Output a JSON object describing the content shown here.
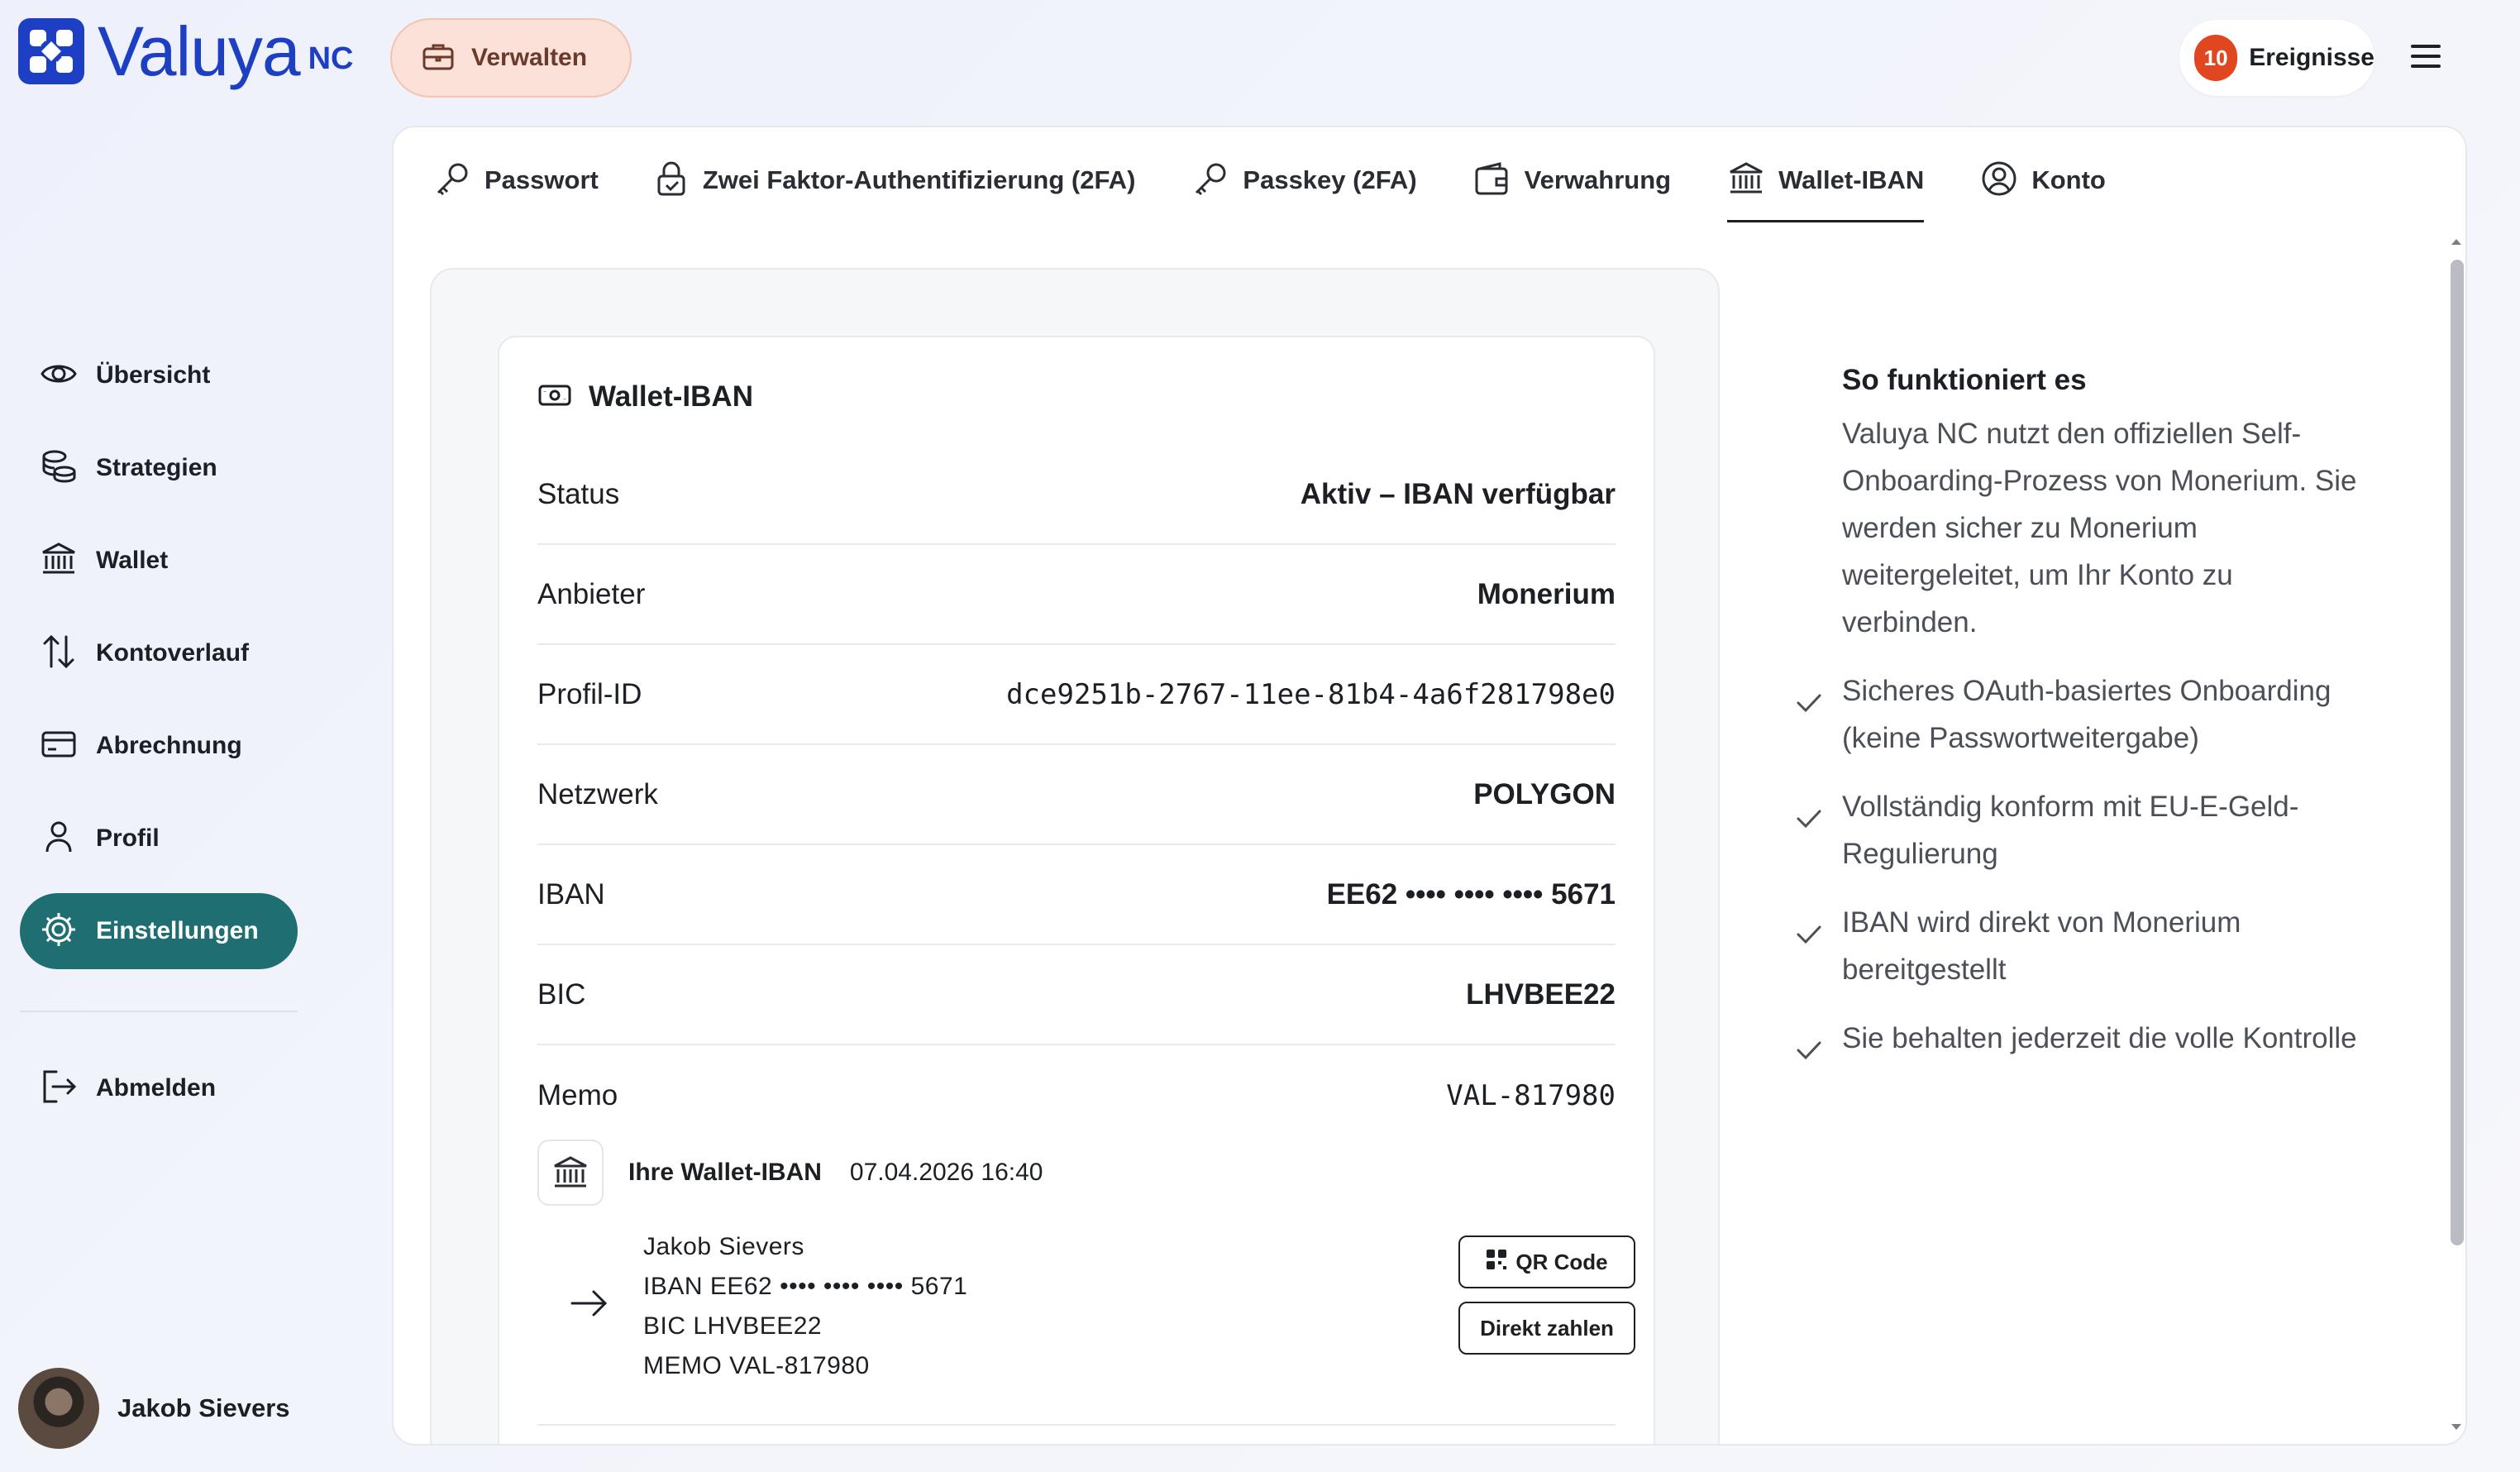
{
  "brand": {
    "name": "Valuya",
    "suffix": "NC",
    "color": "#1d3fc4"
  },
  "header": {
    "manage_label": "Verwalten",
    "events_count": "10",
    "events_label": "Ereignisse"
  },
  "sidebar": {
    "items": [
      {
        "label": "Übersicht",
        "icon": "eye-icon"
      },
      {
        "label": "Strategien",
        "icon": "coins-icon"
      },
      {
        "label": "Wallet",
        "icon": "bank-icon"
      },
      {
        "label": "Kontoverlauf",
        "icon": "arrows-updown-icon"
      },
      {
        "label": "Abrechnung",
        "icon": "card-icon"
      },
      {
        "label": "Profil",
        "icon": "user-icon"
      },
      {
        "label": "Einstellungen",
        "icon": "gear-icon",
        "active": true
      }
    ],
    "logout_label": "Abmelden",
    "user_name": "Jakob Sievers"
  },
  "tabs": [
    {
      "label": "Passwort",
      "icon": "key-icon"
    },
    {
      "label": "Zwei Faktor-Authentifizierung (2FA)",
      "icon": "lock-icon"
    },
    {
      "label": "Passkey (2FA)",
      "icon": "key-icon"
    },
    {
      "label": "Verwahrung",
      "icon": "wallet-icon"
    },
    {
      "label": "Wallet-IBAN",
      "icon": "bank-icon",
      "active": true
    },
    {
      "label": "Konto",
      "icon": "user-circle-icon"
    }
  ],
  "wallet_card": {
    "title": "Wallet-IBAN",
    "rows": [
      {
        "key": "Status",
        "value": "Aktiv – IBAN verfügbar"
      },
      {
        "key": "Anbieter",
        "value": "Monerium"
      },
      {
        "key": "Profil-ID",
        "value": "dce9251b-2767-11ee-81b4-4a6f281798e0"
      },
      {
        "key": "Netzwerk",
        "value": "POLYGON"
      },
      {
        "key": "IBAN",
        "value": "EE62 •••• •••• •••• 5671"
      },
      {
        "key": "BIC",
        "value": "LHVBEE22"
      },
      {
        "key": "Memo",
        "value": "VAL-817980"
      }
    ],
    "transfer": {
      "title": "Ihre Wallet-IBAN",
      "date": "07.04.2026 16:40",
      "lines": [
        "Jakob Sievers",
        "IBAN EE62 •••• •••• •••• 5671",
        "BIC LHVBEE22",
        "MEMO VAL-817980"
      ],
      "qr_label": "QR Code",
      "pay_label": "Direkt zahlen"
    }
  },
  "how_it_works": {
    "title": "So funktioniert es",
    "intro": "Valuya NC nutzt den offiziellen Self-Onboarding-Prozess von Monerium. Sie werden sicher zu Monerium weitergeleitet, um Ihr Konto zu verbinden.",
    "points": [
      "Sicheres OAuth-basiertes Onboarding (keine Passwortweitergabe)",
      "Vollständig konform mit EU-E-Geld-Regulierung",
      "IBAN wird direkt von Monerium bereitgestellt",
      "Sie behalten jederzeit die volle Kontrolle"
    ]
  }
}
